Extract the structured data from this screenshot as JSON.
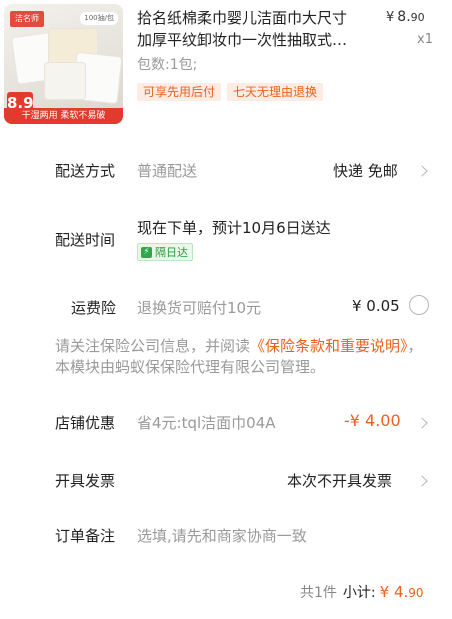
{
  "product": {
    "image": {
      "brand_label": "洁名师",
      "count_label": "100抽/包",
      "price_badge": "8.9",
      "bottom_caption": "干湿两用 柔软不易破"
    },
    "title_line1": "拾名纸棉柔巾婴儿洁面巾大尺寸",
    "title_line2": "加厚平纹卸妆巾一次性抽取式…",
    "price_currency": "¥",
    "price_integer": "8.",
    "price_decimal": "90",
    "quantity": "x1",
    "spec": "包数:1包;",
    "tags": [
      "可享先用后付",
      "七天无理由退换"
    ]
  },
  "delivery_method": {
    "label": "配送方式",
    "value": "普通配送",
    "option": "快递 免邮"
  },
  "delivery_time": {
    "label": "配送时间",
    "value": "现在下单，预计10月6日送达",
    "badge_icon": "lightning-icon",
    "badge": "隔日达"
  },
  "shipping_insurance": {
    "label": "运费险",
    "value": "退换货可赔付10元",
    "price": "¥ 0.05"
  },
  "notice": {
    "prefix": "请关注保险公司信息，并阅读",
    "link": "《保险条款和重要说明》",
    "suffix": "，本模块由蚂蚁保保险代理有限公司管理。"
  },
  "store_discount": {
    "label": "店铺优惠",
    "value": "省4元:tql洁面巾04A",
    "amount": "-¥ 4.00"
  },
  "invoice": {
    "label": "开具发票",
    "value": "本次不开具发票"
  },
  "remark": {
    "label": "订单备注",
    "placeholder": "选填,请先和商家协商一致"
  },
  "summary": {
    "count": "共1件",
    "subtotal_label": "小计:",
    "currency": "¥",
    "integer": "4.",
    "decimal": "90"
  },
  "colors": {
    "accent": "#f0601c",
    "muted": "#9a9a9a",
    "badge_green": "#2e9b3f"
  }
}
